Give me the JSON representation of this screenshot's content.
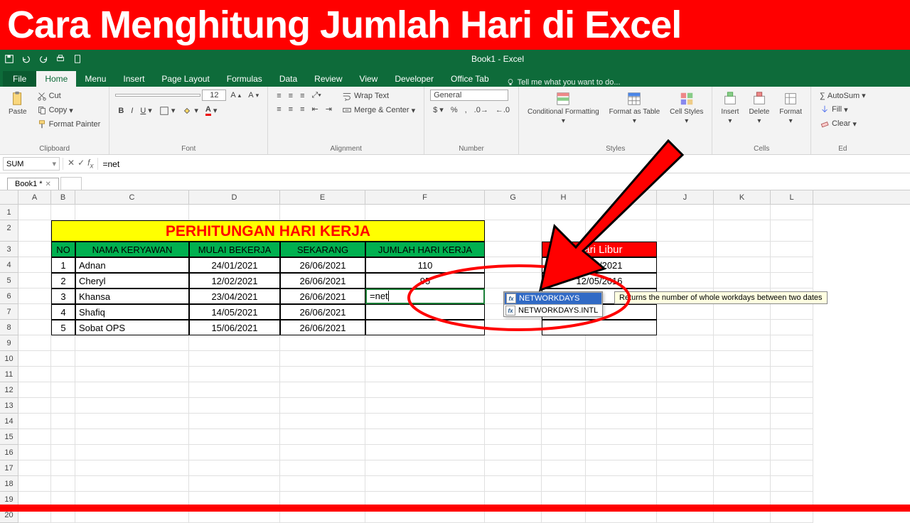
{
  "banner": "Cara Menghitung Jumlah Hari di Excel",
  "window_title": "Book1 - Excel",
  "tabs": {
    "file": "File",
    "home": "Home",
    "menu": "Menu",
    "insert": "Insert",
    "page_layout": "Page Layout",
    "formulas": "Formulas",
    "data": "Data",
    "review": "Review",
    "view": "View",
    "developer": "Developer",
    "office_tab": "Office Tab",
    "tell_me": "Tell me what you want to do..."
  },
  "ribbon": {
    "clipboard": {
      "label": "Clipboard",
      "paste": "Paste",
      "cut": "Cut",
      "copy": "Copy",
      "format_painter": "Format Painter"
    },
    "font": {
      "label": "Font",
      "name": "",
      "size": "12"
    },
    "alignment": {
      "label": "Alignment",
      "wrap": "Wrap Text",
      "merge": "Merge & Center"
    },
    "number": {
      "label": "Number",
      "format": "General"
    },
    "styles": {
      "label": "Styles",
      "cond": "Conditional Formatting",
      "table": "Format as Table",
      "cell": "Cell Styles"
    },
    "cells": {
      "label": "Cells",
      "insert": "Insert",
      "delete": "Delete",
      "format": "Format"
    },
    "editing": {
      "label": "Ed",
      "autosum": "AutoSum",
      "fill": "Fill",
      "clear": "Clear"
    }
  },
  "namebox": "SUM",
  "formula": "=net",
  "sheet_tab": "Book1 *",
  "columns": [
    "A",
    "B",
    "C",
    "D",
    "E",
    "F",
    "G",
    "H",
    "I",
    "J",
    "K",
    "L"
  ],
  "table": {
    "title": "PERHITUNGAN HARI KERJA",
    "headers": {
      "no": "NO",
      "nama": "NAMA KERYAWAN",
      "mulai": "MULAI BEKERJA",
      "sekarang": "SEKARANG",
      "jumlah": "JUMLAH HARI KERJA"
    },
    "rows": [
      {
        "no": "1",
        "nama": "Adnan",
        "mulai": "24/01/2021",
        "sekarang": "26/06/2021",
        "jumlah": "110"
      },
      {
        "no": "2",
        "nama": "Cheryl",
        "mulai": "12/02/2021",
        "sekarang": "26/06/2021",
        "jumlah": "95"
      },
      {
        "no": "3",
        "nama": "Khansa",
        "mulai": "23/04/2021",
        "sekarang": "26/06/2021",
        "jumlah": "=net"
      },
      {
        "no": "4",
        "nama": "Shafiq",
        "mulai": "14/05/2021",
        "sekarang": "26/06/2021",
        "jumlah": ""
      },
      {
        "no": "5",
        "nama": "Sobat OPS",
        "mulai": "15/06/2021",
        "sekarang": "26/06/2021",
        "jumlah": ""
      }
    ]
  },
  "holiday": {
    "title": "Hari Libur",
    "rows": [
      "14/06/2021",
      "12/05/2016",
      "",
      "",
      ""
    ]
  },
  "autocomplete": {
    "items": [
      "NETWORKDAYS",
      "NETWORKDAYS.INTL"
    ],
    "tip": "Returns the number of whole workdays between two dates"
  }
}
